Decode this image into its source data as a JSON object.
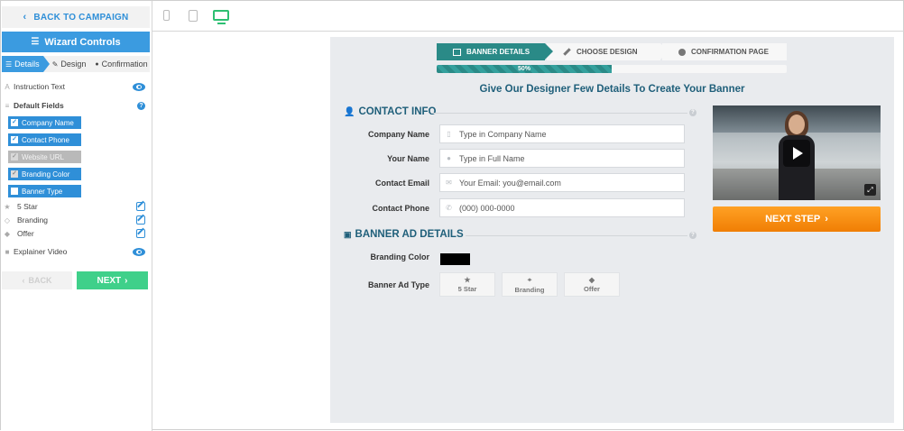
{
  "sidebar": {
    "back_label": "BACK TO CAMPAIGN",
    "title": "Wizard Controls",
    "tabs": [
      {
        "label": "Details"
      },
      {
        "label": "Design"
      },
      {
        "label": "Confirmation"
      }
    ],
    "instruction_text": "Instruction Text",
    "default_fields": "Default Fields",
    "fields": [
      {
        "label": "Company Name",
        "checked": true
      },
      {
        "label": "Contact Phone",
        "checked": true
      },
      {
        "label": "Website URL",
        "checked": false
      },
      {
        "label": "Branding Color",
        "checked": true
      },
      {
        "label": "Banner Type",
        "checked": false
      }
    ],
    "banner_options": [
      {
        "label": "5 Star"
      },
      {
        "label": "Branding"
      },
      {
        "label": "Offer"
      }
    ],
    "explainer_video": "Explainer Video",
    "back_button": "BACK",
    "next_button": "NEXT"
  },
  "wizard": {
    "steps": [
      {
        "label": "BANNER DETAILS"
      },
      {
        "label": "CHOOSE DESIGN"
      },
      {
        "label": "CONFIRMATION PAGE"
      }
    ],
    "progress_label": "50%",
    "progress_value": 0.5,
    "headline": "Give Our Designer Few Details To Create Your Banner",
    "contact_info_title": "CONTACT INFO",
    "contact_fields": [
      {
        "label": "Company Name",
        "placeholder": "Type in Company Name"
      },
      {
        "label": "Your Name",
        "placeholder": "Type in Full Name"
      },
      {
        "label": "Contact Email",
        "placeholder": "Your Email: you@email.com"
      },
      {
        "label": "Contact Phone",
        "placeholder": "(000) 000-0000"
      }
    ],
    "banner_ad_title": "BANNER AD DETAILS",
    "branding_color_label": "Branding Color",
    "branding_color_value": "#000000",
    "banner_ad_type_label": "Banner Ad Type",
    "ad_types": [
      {
        "label": "5 Star"
      },
      {
        "label": "Branding"
      },
      {
        "label": "Offer"
      }
    ],
    "next_step": "NEXT STEP"
  },
  "colors": {
    "accent_blue": "#3b9be0",
    "step_teal": "#2a8a87",
    "next_green": "#3fd08a",
    "next_step_orange": "#f07e04",
    "heading_navy": "#1f5f7a"
  }
}
